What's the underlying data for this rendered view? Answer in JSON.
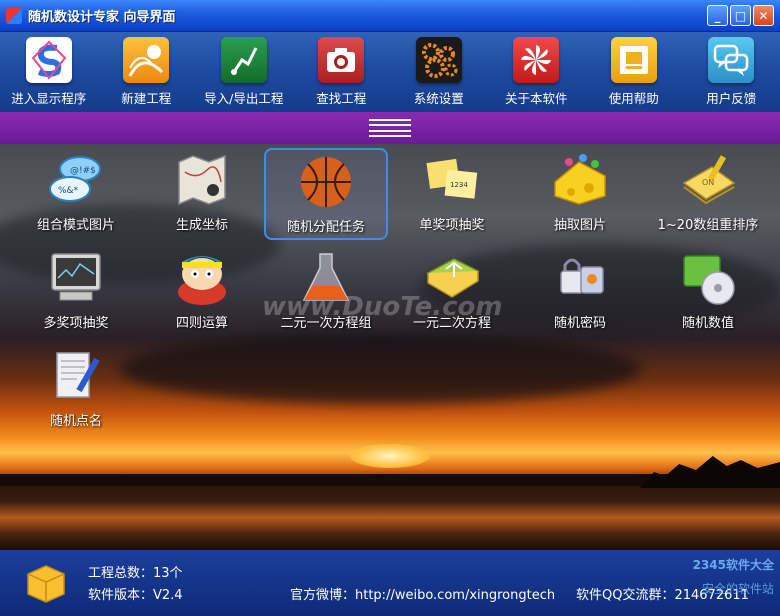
{
  "window": {
    "title": "随机数设计专家  向导界面",
    "buttons": [
      "_",
      "□",
      "✕"
    ]
  },
  "toolbar": [
    {
      "label": "进入显示程序",
      "icon": "s-logo-icon",
      "color": "#e84a8a"
    },
    {
      "label": "新建工程",
      "icon": "new-project-icon",
      "color": "#f4a020"
    },
    {
      "label": "导入/导出工程",
      "icon": "import-export-icon",
      "color": "#1e8a3a"
    },
    {
      "label": "查找工程",
      "icon": "camera-icon",
      "color": "#c43a3a"
    },
    {
      "label": "系统设置",
      "icon": "gears-icon",
      "color": "#2a2a2a"
    },
    {
      "label": "关于本软件",
      "icon": "pinwheel-icon",
      "color": "#d82a2a"
    },
    {
      "label": "使用帮助",
      "icon": "help-icon",
      "color": "#f0b020"
    },
    {
      "label": "用户反馈",
      "icon": "chat-bubbles-icon",
      "color": "#3ab0e0"
    }
  ],
  "grid": [
    {
      "label": "组合模式图片",
      "icon": "chat-symbols-icon"
    },
    {
      "label": "生成坐标",
      "icon": "map-icon"
    },
    {
      "label": "随机分配任务",
      "icon": "basketball-icon",
      "selected": true
    },
    {
      "label": "单奖项抽奖",
      "icon": "sticky-notes-icon"
    },
    {
      "label": "抽取图片",
      "icon": "cheese-icon"
    },
    {
      "label": "1~20数组重排序",
      "icon": "notebook-icon"
    },
    {
      "label": "多奖项抽奖",
      "icon": "monitor-icon"
    },
    {
      "label": "四则运算",
      "icon": "cartoon-kid-icon"
    },
    {
      "label": "二元一次方程组",
      "icon": "flask-icon"
    },
    {
      "label": "一元二次方程",
      "icon": "book-icon"
    },
    {
      "label": "随机密码",
      "icon": "lock-icon"
    },
    {
      "label": "随机数值",
      "icon": "cd-icon"
    },
    {
      "label": "随机点名",
      "icon": "document-pen-icon"
    }
  ],
  "watermark": "www.DuoTe.com",
  "status": {
    "project_count": "工程总数：13个",
    "version": "软件版本：V2.4",
    "weibo": "官方微博：http://weibo.com/xingrongtech",
    "qq": "软件QQ交流群：214672611",
    "logo1": "2345软件大全",
    "logo2": "安全的软件站"
  }
}
